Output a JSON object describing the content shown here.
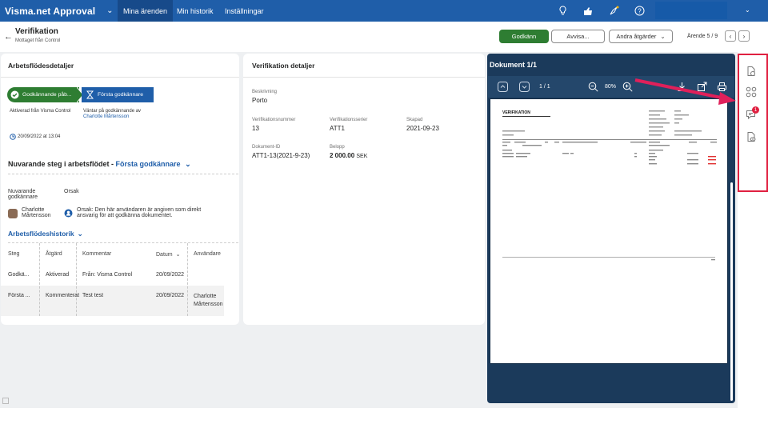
{
  "topbar": {
    "brand": "Visma.net Approval",
    "nav": [
      "Mina ärenden",
      "Min historik",
      "Inställningar"
    ]
  },
  "header": {
    "title": "Verifikation",
    "subtitle": "Mottaget från Control",
    "approve": "Godkänn",
    "reject": "Avvisa...",
    "other_actions": "Andra åtgärder",
    "case_counter": "Ärende 5 / 9"
  },
  "workflow": {
    "title": "Arbetsflödesdetaljer",
    "step1": "Godkännande påb...",
    "step2": "Första godkännare",
    "step1_note": "Aktiverad från Visma Control",
    "step2_note_a": "Väntar på godkännande av",
    "step2_note_b": "Charlotte Mårtensson",
    "date": "20/09/2022 at 13:04",
    "current_prefix": "Nuvarande steg i arbetsflödet -",
    "current_step": "Första godkännare",
    "col_approver_a": "Nuvarande",
    "col_approver_b": "godkännare",
    "col_reason": "Orsak",
    "approver_a": "Charlotte",
    "approver_b": "Mårtensson",
    "reason_a": "Orsak: Den här användaren är angiven som direkt",
    "reason_b": "ansvarig för att godkänna dokumentet.",
    "history_title": "Arbetsflödeshistorik",
    "history_headers": [
      "Steg",
      "Åtgärd",
      "Kommentar",
      "Datum",
      "Användare"
    ],
    "history_rows": [
      [
        "Godkä...",
        "Aktiverad",
        "Från: Visma Control",
        "20/09/2022",
        ""
      ],
      [
        "Första ...",
        "Kommenterat",
        "Test test",
        "20/09/2022",
        "Charlotte Mårtensson"
      ]
    ]
  },
  "details": {
    "title": "Verifikation detaljer",
    "desc_label": "Beskrivning",
    "desc_value": "Porto",
    "num_label": "Verifikationsnummer",
    "num_value": "13",
    "series_label": "Verifikationsserier",
    "series_value": "ATT1",
    "created_label": "Skapad",
    "created_value": "2021-09-23",
    "docid_label": "Dokument-ID",
    "docid_value": "ATT1-13(2021-9-23)",
    "amount_label": "Belopp",
    "amount_value": "2 000.00",
    "amount_currency": "SEK"
  },
  "document": {
    "title": "Dokument 1/1",
    "page": "1 / 1",
    "zoom": "80%",
    "doc_heading": "VERIFIKATION"
  },
  "rail": {
    "badge": "1"
  }
}
